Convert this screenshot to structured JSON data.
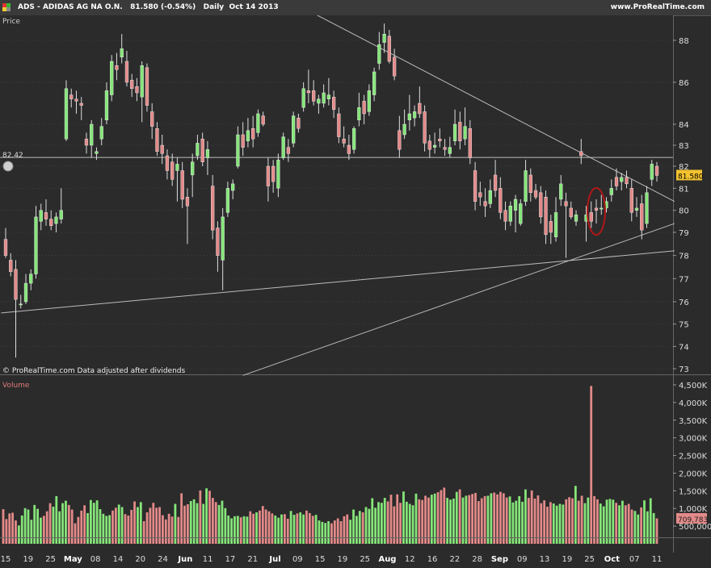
{
  "header": {
    "symbol": "ADS",
    "name": "ADIDAS AG NA O.N.",
    "last": "81.580",
    "change": "(-0.54%)",
    "period": "Daily",
    "date": "Oct 14 2013",
    "brand": "www.ProRealTime.com"
  },
  "price_panel": {
    "label": "Price",
    "footer": "© ProRealTime.com  Data adjusted after dividends",
    "hline_label": "82.42",
    "last_badge": "81.580"
  },
  "volume_panel": {
    "label": "Volume",
    "last_badge": "709,783"
  },
  "colors": {
    "up": "#86e67a",
    "down": "#e48a8a",
    "background": "#2b2b2b",
    "grid": "#555555",
    "line": "#bbbbbb",
    "badge": "#f2c230",
    "circle": "#b01818"
  },
  "chart_data": [
    {
      "type": "candlestick",
      "title": "Price",
      "y_ticks": [
        73,
        74,
        75,
        76,
        77,
        78,
        79,
        80,
        81,
        82,
        83,
        84,
        86,
        88
      ],
      "x_ticks": [
        "15",
        "19",
        "25",
        "May",
        "08",
        "14",
        "20",
        "24",
        "Jun",
        "11",
        "17",
        "21",
        "Jul",
        "09",
        "15",
        "19",
        "25",
        "Aug",
        "12",
        "16",
        "22",
        "28",
        "Sep",
        "09",
        "13",
        "19",
        "25",
        "Oct",
        "07",
        "11"
      ],
      "horizontal_line": 82.42,
      "candles": [
        {
          "o": 78.7,
          "h": 79.2,
          "l": 77.9,
          "c": 78.0
        },
        {
          "o": 77.8,
          "h": 78.1,
          "l": 77.1,
          "c": 77.3
        },
        {
          "o": 77.4,
          "h": 77.8,
          "l": 73.5,
          "c": 76.1
        },
        {
          "o": 75.9,
          "h": 76.3,
          "l": 75.7,
          "c": 75.9
        },
        {
          "o": 76.0,
          "h": 77.2,
          "l": 75.9,
          "c": 76.8
        },
        {
          "o": 76.8,
          "h": 77.4,
          "l": 76.5,
          "c": 77.2
        },
        {
          "o": 77.2,
          "h": 80.2,
          "l": 77.0,
          "c": 79.7
        },
        {
          "o": 79.5,
          "h": 80.3,
          "l": 79.1,
          "c": 80.0
        },
        {
          "o": 79.9,
          "h": 80.5,
          "l": 79.3,
          "c": 79.6
        },
        {
          "o": 79.6,
          "h": 80.0,
          "l": 79.1,
          "c": 79.3
        },
        {
          "o": 79.4,
          "h": 79.9,
          "l": 79.0,
          "c": 79.7
        },
        {
          "o": 79.6,
          "h": 81.0,
          "l": 79.4,
          "c": 80.0
        },
        {
          "o": 83.3,
          "h": 86.1,
          "l": 83.2,
          "c": 85.7
        },
        {
          "o": 85.4,
          "h": 85.7,
          "l": 84.8,
          "c": 85.2
        },
        {
          "o": 85.2,
          "h": 85.6,
          "l": 84.5,
          "c": 85.1
        },
        {
          "o": 85.0,
          "h": 85.3,
          "l": 84.2,
          "c": 84.9
        },
        {
          "o": 83.3,
          "h": 83.6,
          "l": 82.6,
          "c": 83.0
        },
        {
          "o": 83.0,
          "h": 84.2,
          "l": 82.4,
          "c": 84.0
        },
        {
          "o": 82.6,
          "h": 82.9,
          "l": 82.3,
          "c": 82.7
        },
        {
          "o": 83.3,
          "h": 84.3,
          "l": 83.0,
          "c": 83.9
        },
        {
          "o": 84.2,
          "h": 86.0,
          "l": 84.0,
          "c": 85.6
        },
        {
          "o": 85.4,
          "h": 87.3,
          "l": 85.1,
          "c": 87.0
        },
        {
          "o": 86.8,
          "h": 87.4,
          "l": 86.1,
          "c": 86.6
        },
        {
          "o": 87.2,
          "h": 88.3,
          "l": 86.9,
          "c": 87.6
        },
        {
          "o": 87.0,
          "h": 87.5,
          "l": 85.8,
          "c": 86.0
        },
        {
          "o": 86.1,
          "h": 86.4,
          "l": 85.3,
          "c": 85.7
        },
        {
          "o": 85.8,
          "h": 86.2,
          "l": 85.1,
          "c": 85.5
        },
        {
          "o": 85.3,
          "h": 87.0,
          "l": 84.1,
          "c": 86.8
        },
        {
          "o": 86.7,
          "h": 86.9,
          "l": 84.6,
          "c": 84.9
        },
        {
          "o": 84.6,
          "h": 85.0,
          "l": 83.3,
          "c": 83.9
        },
        {
          "o": 83.8,
          "h": 84.1,
          "l": 82.5,
          "c": 82.7
        },
        {
          "o": 83.0,
          "h": 83.5,
          "l": 82.1,
          "c": 82.6
        },
        {
          "o": 82.5,
          "h": 82.8,
          "l": 81.4,
          "c": 81.8
        },
        {
          "o": 82.2,
          "h": 82.6,
          "l": 81.1,
          "c": 81.4
        },
        {
          "o": 81.8,
          "h": 82.4,
          "l": 80.4,
          "c": 82.1
        },
        {
          "o": 81.8,
          "h": 82.2,
          "l": 80.1,
          "c": 80.5
        },
        {
          "o": 80.6,
          "h": 81.0,
          "l": 78.5,
          "c": 80.2
        },
        {
          "o": 81.6,
          "h": 82.6,
          "l": 80.6,
          "c": 82.2
        },
        {
          "o": 82.5,
          "h": 83.5,
          "l": 82.3,
          "c": 83.1
        },
        {
          "o": 83.3,
          "h": 83.6,
          "l": 82.0,
          "c": 82.2
        },
        {
          "o": 82.4,
          "h": 83.2,
          "l": 81.6,
          "c": 82.8
        },
        {
          "o": 81.1,
          "h": 81.6,
          "l": 78.7,
          "c": 79.1
        },
        {
          "o": 79.2,
          "h": 79.5,
          "l": 77.3,
          "c": 78.0
        },
        {
          "o": 77.8,
          "h": 80.1,
          "l": 76.5,
          "c": 79.7
        },
        {
          "o": 79.9,
          "h": 81.3,
          "l": 79.7,
          "c": 81.0
        },
        {
          "o": 80.9,
          "h": 81.4,
          "l": 80.5,
          "c": 81.2
        },
        {
          "o": 82.0,
          "h": 83.9,
          "l": 81.9,
          "c": 83.5
        },
        {
          "o": 83.5,
          "h": 84.1,
          "l": 82.5,
          "c": 82.9
        },
        {
          "o": 83.2,
          "h": 84.3,
          "l": 82.9,
          "c": 83.7
        },
        {
          "o": 83.8,
          "h": 84.4,
          "l": 82.9,
          "c": 83.3
        },
        {
          "o": 83.6,
          "h": 84.7,
          "l": 83.4,
          "c": 84.5
        },
        {
          "o": 84.4,
          "h": 84.6,
          "l": 83.9,
          "c": 84.0
        },
        {
          "o": 82.0,
          "h": 82.4,
          "l": 80.4,
          "c": 81.1
        },
        {
          "o": 82.0,
          "h": 82.3,
          "l": 80.8,
          "c": 81.3
        },
        {
          "o": 81.0,
          "h": 82.6,
          "l": 80.6,
          "c": 82.3
        },
        {
          "o": 82.4,
          "h": 83.6,
          "l": 82.3,
          "c": 83.4
        },
        {
          "o": 82.9,
          "h": 83.3,
          "l": 82.2,
          "c": 82.6
        },
        {
          "o": 83.1,
          "h": 84.6,
          "l": 82.9,
          "c": 84.4
        },
        {
          "o": 84.3,
          "h": 84.5,
          "l": 83.6,
          "c": 83.8
        },
        {
          "o": 84.8,
          "h": 86.0,
          "l": 84.6,
          "c": 85.7
        },
        {
          "o": 85.6,
          "h": 86.6,
          "l": 85.0,
          "c": 85.5
        },
        {
          "o": 85.6,
          "h": 86.1,
          "l": 84.9,
          "c": 85.1
        },
        {
          "o": 85.0,
          "h": 85.4,
          "l": 84.5,
          "c": 85.2
        },
        {
          "o": 85.0,
          "h": 85.9,
          "l": 84.8,
          "c": 85.5
        },
        {
          "o": 85.2,
          "h": 86.2,
          "l": 84.9,
          "c": 85.4
        },
        {
          "o": 85.3,
          "h": 85.6,
          "l": 84.3,
          "c": 84.7
        },
        {
          "o": 84.5,
          "h": 84.8,
          "l": 83.1,
          "c": 83.4
        },
        {
          "o": 83.3,
          "h": 83.9,
          "l": 82.9,
          "c": 83.1
        },
        {
          "o": 83.0,
          "h": 83.5,
          "l": 82.3,
          "c": 82.6
        },
        {
          "o": 82.8,
          "h": 83.9,
          "l": 82.6,
          "c": 83.8
        },
        {
          "o": 84.2,
          "h": 85.5,
          "l": 83.9,
          "c": 84.8
        },
        {
          "o": 85.1,
          "h": 85.4,
          "l": 84.0,
          "c": 84.5
        },
        {
          "o": 84.6,
          "h": 85.9,
          "l": 84.4,
          "c": 85.6
        },
        {
          "o": 85.4,
          "h": 86.7,
          "l": 85.1,
          "c": 86.5
        },
        {
          "o": 86.9,
          "h": 88.4,
          "l": 86.6,
          "c": 87.8
        },
        {
          "o": 87.9,
          "h": 88.8,
          "l": 87.4,
          "c": 88.3
        },
        {
          "o": 88.2,
          "h": 88.5,
          "l": 86.9,
          "c": 87.0
        },
        {
          "o": 87.2,
          "h": 87.6,
          "l": 86.1,
          "c": 86.3
        },
        {
          "o": 83.7,
          "h": 84.4,
          "l": 82.4,
          "c": 82.8
        },
        {
          "o": 83.5,
          "h": 84.7,
          "l": 83.3,
          "c": 84.0
        },
        {
          "o": 84.2,
          "h": 85.4,
          "l": 83.7,
          "c": 84.5
        },
        {
          "o": 84.3,
          "h": 84.9,
          "l": 83.9,
          "c": 84.6
        },
        {
          "o": 85.0,
          "h": 85.8,
          "l": 84.3,
          "c": 84.5
        },
        {
          "o": 84.6,
          "h": 84.9,
          "l": 82.7,
          "c": 83.1
        },
        {
          "o": 83.2,
          "h": 83.5,
          "l": 82.4,
          "c": 82.8
        },
        {
          "o": 82.9,
          "h": 83.6,
          "l": 82.6,
          "c": 83.0
        },
        {
          "o": 83.3,
          "h": 83.8,
          "l": 82.9,
          "c": 83.2
        },
        {
          "o": 82.9,
          "h": 83.3,
          "l": 82.5,
          "c": 82.8
        },
        {
          "o": 82.6,
          "h": 83.4,
          "l": 82.4,
          "c": 82.9
        },
        {
          "o": 83.2,
          "h": 84.7,
          "l": 83.0,
          "c": 84.0
        },
        {
          "o": 84.1,
          "h": 84.6,
          "l": 82.8,
          "c": 83.2
        },
        {
          "o": 83.3,
          "h": 84.8,
          "l": 83.0,
          "c": 83.9
        },
        {
          "o": 83.8,
          "h": 84.2,
          "l": 82.1,
          "c": 82.4
        },
        {
          "o": 81.8,
          "h": 82.2,
          "l": 80.0,
          "c": 80.4
        },
        {
          "o": 80.8,
          "h": 81.3,
          "l": 80.2,
          "c": 80.6
        },
        {
          "o": 80.4,
          "h": 81.0,
          "l": 79.7,
          "c": 80.2
        },
        {
          "o": 80.3,
          "h": 81.4,
          "l": 80.1,
          "c": 80.9
        },
        {
          "o": 81.6,
          "h": 82.3,
          "l": 80.6,
          "c": 80.9
        },
        {
          "o": 81.0,
          "h": 81.5,
          "l": 79.6,
          "c": 79.9
        },
        {
          "o": 80.0,
          "h": 80.4,
          "l": 79.1,
          "c": 79.5
        },
        {
          "o": 79.5,
          "h": 80.4,
          "l": 79.3,
          "c": 80.2
        },
        {
          "o": 80.0,
          "h": 80.7,
          "l": 79.0,
          "c": 80.5
        },
        {
          "o": 79.4,
          "h": 80.5,
          "l": 79.3,
          "c": 80.3
        },
        {
          "o": 80.4,
          "h": 82.3,
          "l": 80.2,
          "c": 81.8
        },
        {
          "o": 81.6,
          "h": 81.9,
          "l": 80.4,
          "c": 80.8
        },
        {
          "o": 80.9,
          "h": 81.2,
          "l": 80.5,
          "c": 80.6
        },
        {
          "o": 80.8,
          "h": 81.1,
          "l": 79.4,
          "c": 79.7
        },
        {
          "o": 80.6,
          "h": 80.9,
          "l": 78.5,
          "c": 78.9
        },
        {
          "o": 79.5,
          "h": 79.8,
          "l": 78.5,
          "c": 79.0
        },
        {
          "o": 78.8,
          "h": 80.6,
          "l": 78.6,
          "c": 79.9
        },
        {
          "o": 80.5,
          "h": 81.6,
          "l": 80.2,
          "c": 81.2
        },
        {
          "o": 80.4,
          "h": 80.8,
          "l": 77.9,
          "c": 80.2
        },
        {
          "o": 80.1,
          "h": 80.4,
          "l": 79.6,
          "c": 79.7
        },
        {
          "o": 79.5,
          "h": 80.0,
          "l": 79.3,
          "c": 79.8
        },
        {
          "o": 82.7,
          "h": 83.3,
          "l": 82.1,
          "c": 82.5
        },
        {
          "o": 79.5,
          "h": 80.2,
          "l": 78.6,
          "c": 79.8
        },
        {
          "o": 79.9,
          "h": 80.4,
          "l": 79.2,
          "c": 79.5
        },
        {
          "o": 80.1,
          "h": 80.5,
          "l": 79.4,
          "c": 80.0
        },
        {
          "o": 80.1,
          "h": 80.7,
          "l": 79.8,
          "c": 80.1
        },
        {
          "o": 80.1,
          "h": 80.6,
          "l": 79.9,
          "c": 80.4
        },
        {
          "o": 80.7,
          "h": 81.4,
          "l": 80.4,
          "c": 81.0
        },
        {
          "o": 81.5,
          "h": 81.9,
          "l": 80.9,
          "c": 81.1
        },
        {
          "o": 81.3,
          "h": 81.7,
          "l": 80.9,
          "c": 81.5
        },
        {
          "o": 81.5,
          "h": 81.8,
          "l": 81.0,
          "c": 81.2
        },
        {
          "o": 81.0,
          "h": 81.4,
          "l": 79.5,
          "c": 79.9
        },
        {
          "o": 80.0,
          "h": 80.6,
          "l": 79.7,
          "c": 80.1
        },
        {
          "o": 80.3,
          "h": 80.7,
          "l": 78.7,
          "c": 79.1
        },
        {
          "o": 79.4,
          "h": 81.1,
          "l": 79.2,
          "c": 80.8
        },
        {
          "o": 81.4,
          "h": 82.3,
          "l": 81.1,
          "c": 82.1
        },
        {
          "o": 82.0,
          "h": 82.2,
          "l": 81.3,
          "c": 81.58
        }
      ]
    },
    {
      "type": "bar",
      "title": "Volume",
      "y_ticks": [
        500000,
        1000000,
        1500000,
        2000000,
        2500000,
        3000000,
        3500000,
        4000000,
        4500000
      ],
      "y_tick_labels": [
        "500,000",
        "1,000K",
        "1,500K",
        "2,000K",
        "2,500K",
        "3,000K",
        "3,500K",
        "4,000K",
        "4,500K"
      ],
      "values": [
        980000,
        700000,
        860000,
        880000,
        660000,
        520000,
        800000,
        1010000,
        970000,
        680000,
        1100000,
        990000,
        740000,
        790000,
        920000,
        1150000,
        1050000,
        1350000,
        920000,
        1150000,
        1220000,
        1100000,
        970000,
        580000,
        760000,
        940000,
        1090000,
        870000,
        1240000,
        1160000,
        1230000,
        980000,
        850000,
        790000,
        810000,
        940000,
        1020000,
        1110000,
        1040000,
        840000,
        800000,
        960000,
        1200000,
        1040000,
        1180000,
        640000,
        890000,
        1020000,
        1160000,
        1020000,
        1040000,
        810000,
        690000,
        850000,
        770000,
        1130000,
        760000,
        1430000,
        1080000,
        1120000,
        1210000,
        1260000,
        1150000,
        1510000,
        1130000,
        1570000,
        1500000,
        1300000,
        1180000,
        1100000,
        1220000,
        1010000,
        800000,
        720000,
        780000,
        790000,
        750000,
        780000,
        770000,
        920000,
        850000,
        890000,
        940000,
        1070000,
        970000,
        920000,
        860000,
        800000,
        740000,
        830000,
        840000,
        710000,
        930000,
        820000,
        860000,
        890000,
        830000,
        940000,
        870000,
        790000,
        820000,
        660000,
        620000,
        590000,
        640000,
        580000,
        660000,
        720000,
        640000,
        780000,
        830000,
        680000,
        970000,
        790000,
        930000,
        890000,
        1040000,
        990000,
        1290000,
        1020000,
        1180000,
        1160000,
        1300000,
        1200000,
        1390000,
        1060000,
        1400000,
        1160000,
        1480000,
        1190000,
        1130000,
        1090000,
        1420000,
        1260000,
        1240000,
        1360000,
        1310000,
        1390000,
        1420000,
        1460000,
        1520000,
        1590000,
        1300000,
        1250000,
        1280000,
        1470000,
        1540000,
        1310000,
        1360000,
        1380000,
        1410000,
        1440000,
        1210000,
        1290000,
        1350000,
        1360000,
        1430000,
        1450000,
        1400000,
        1470000,
        1430000,
        1310000,
        1340000,
        1170000,
        1220000,
        1350000,
        1190000,
        1540000,
        1300000,
        1510000,
        1280000,
        1370000,
        1150000,
        1230000,
        1050000,
        1180000,
        1140000,
        1080000,
        1130000,
        1110000,
        1260000,
        1320000,
        1290000,
        1640000,
        1220000,
        1360000,
        1150000,
        1310000,
        4470000,
        1350000,
        1260000,
        1140000,
        1060000,
        1250000,
        1270000,
        1250000,
        1160000,
        1090000,
        1220000,
        1090000,
        1130000,
        970000,
        930000,
        830000,
        1030000,
        1230000,
        920000,
        1290000,
        870000,
        720000
      ]
    }
  ]
}
